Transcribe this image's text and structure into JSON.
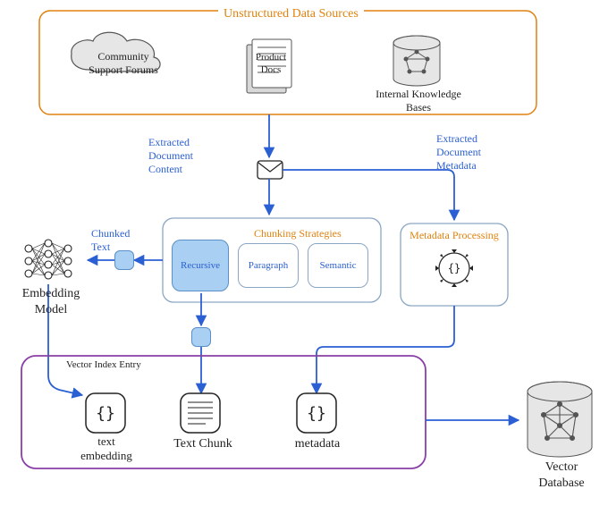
{
  "title": "Unstructured Data Sources",
  "sources": {
    "forums": "Community\nSupport Forums",
    "docs": "Product\nDocs",
    "kb": "Internal Knowledge\nBases"
  },
  "flow": {
    "extracted_content": "Extracted\nDocument\nContent",
    "extracted_metadata": "Extracted\nDocument\nMetadata",
    "chunked_text": "Chunked\nText"
  },
  "chunking": {
    "title": "Chunking Strategies",
    "recursive": "Recursive",
    "paragraph": "Paragraph",
    "semantic": "Semantic"
  },
  "metadata": {
    "title": "Metadata Processing"
  },
  "embedding": {
    "model": "Embedding\nModel"
  },
  "vector_entry": {
    "title": "Vector Index Entry",
    "text_embedding": "text\nembedding",
    "text_chunk": "Text Chunk",
    "metadata": "metadata"
  },
  "vector_db": "Vector\nDatabase"
}
